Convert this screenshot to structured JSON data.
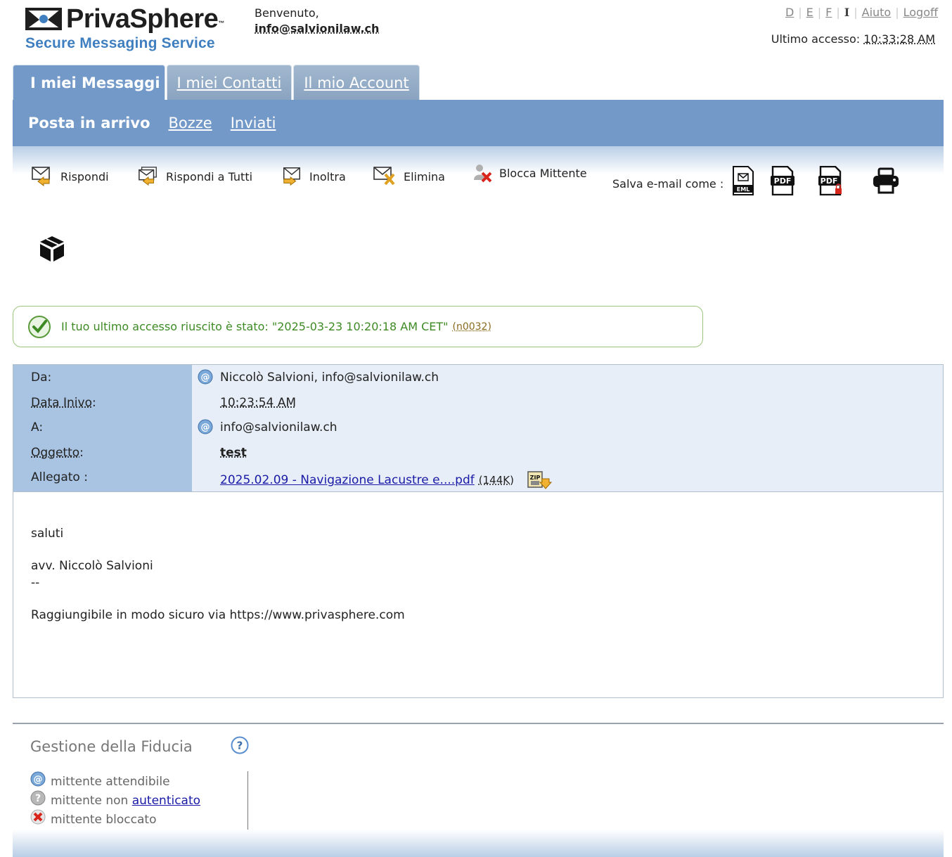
{
  "header": {
    "brand": "PrivaSphere",
    "trademark": "™",
    "tagline": "Secure Messaging Service",
    "welcome": "Benvenuto,",
    "user_email": "info@salvionilaw.ch",
    "languages": [
      "D",
      "E",
      "F",
      "I"
    ],
    "active_language": "I",
    "help_link": "Aiuto",
    "logoff_link": "Logoff",
    "last_access_label": "Ultimo accesso:",
    "last_access_time": "10:33:28 AM"
  },
  "tabs": [
    {
      "label": "I miei Messaggi",
      "active": true
    },
    {
      "label": "I miei Contatti",
      "active": false
    },
    {
      "label": "Il mio Account",
      "active": false
    }
  ],
  "subnav": [
    {
      "label": "Posta in arrivo",
      "active": true
    },
    {
      "label": "Bozze",
      "active": false
    },
    {
      "label": "Inviati",
      "active": false
    }
  ],
  "toolbar": {
    "reply": "Rispondi",
    "reply_all": "Rispondi a Tutti",
    "forward": "Inoltra",
    "delete": "Elimina",
    "block_sender": "Blocca Mittente",
    "save_as": "Salva e-mail come :",
    "save_icons": [
      "eml-file-icon",
      "pdf-file-icon",
      "pdf-locked-file-icon",
      "printer-icon"
    ],
    "package_icon": "package-icon"
  },
  "notice": {
    "text": "Il tuo ultimo accesso riuscito è stato: \"2025-03-23 10:20:18 AM CET\"",
    "code": "(n0032)"
  },
  "message": {
    "from_label": "Da:",
    "from_value": "Niccolò Salvioni, info@salvionilaw.ch",
    "date_label": "Data Inivo",
    "date_colon": ":",
    "date_value": "10:23:54 AM",
    "to_label": "A:",
    "to_value": "info@salvionilaw.ch",
    "subject_label": "Oggetto",
    "subject_colon": ":",
    "subject_value": "test",
    "attachment_label": "Allegato :",
    "attachment_name": "2025.02.09 - Navigazione Lacustre e....pdf",
    "attachment_size": "(144K)",
    "body_lines": [
      "saluti",
      "avv. Niccolò Salvioni",
      "--",
      "Raggiungibile in modo sicuro via https://www.privasphere.com"
    ]
  },
  "trust": {
    "title": "Gestione della Fiducia",
    "trusted": "mittente attendibile",
    "unauth_prefix": "mittente non ",
    "unauth_link": "autenticato",
    "blocked": "mittente bloccato"
  },
  "colors": {
    "nav_blue": "#7399c9",
    "label_blue": "#a9c4e2",
    "header_bg": "#e7eef7",
    "success_green": "#3d8a24",
    "brand_blue": "#3f7fc0"
  }
}
